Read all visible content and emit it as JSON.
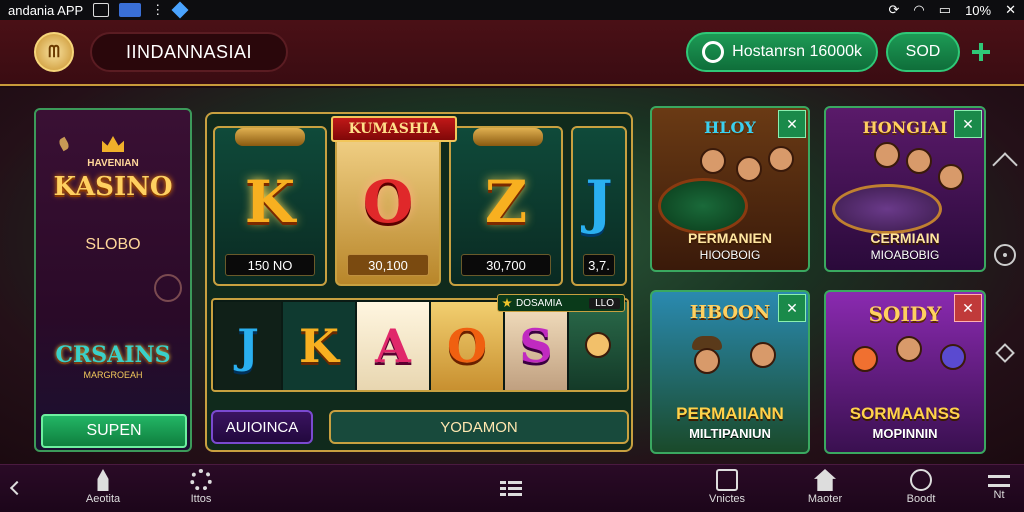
{
  "status_bar": {
    "app_label": "andania APP",
    "battery": "10%"
  },
  "header": {
    "brand": "IINDANNASIAI",
    "balance_label": "Hostanrsn 16000k",
    "sod_label": "SOD"
  },
  "left_panel": {
    "subtitle": "HAVENIAN",
    "title": "KASINO",
    "slobo": "SLOBO",
    "crsains": "CRSAINS",
    "crsains_sub": "MARGROEAH",
    "button": "SUPEN"
  },
  "slot_panel": {
    "banner": "KUMASHIA",
    "reels": [
      {
        "symbol": "K",
        "value": "150 NO"
      },
      {
        "symbol": "O",
        "value": "30,100"
      },
      {
        "symbol": "Z",
        "value": "30,700"
      },
      {
        "symbol": "J",
        "value": "3,7."
      }
    ],
    "lower_tiles": [
      "J",
      "K",
      "A",
      "O",
      "S"
    ],
    "bonus_tag": {
      "label": "DOSAMIA",
      "value": "LLO"
    },
    "btn_left": "AUIOINCA",
    "btn_main": "YODAMON"
  },
  "cards": [
    {
      "title": "HLOY",
      "name": "PERMANIEN",
      "sub": "HIOOBOIG",
      "badge": "✕"
    },
    {
      "title": "HONGIAI",
      "name": "CERMIAIN",
      "sub": "MIOABOBIG",
      "badge": "✕"
    },
    {
      "title": "HBOON",
      "name": "PERMAIIANN",
      "sub": "MILTIPANIUN",
      "badge": "✕"
    },
    {
      "title": "SOIDY",
      "name": "SORMAANSS",
      "sub": "MOPINNIN",
      "badge": "✕"
    }
  ],
  "bottom_nav": {
    "items": [
      {
        "label": "Aeotita",
        "icon": "rocket-icon"
      },
      {
        "label": "Ittos",
        "icon": "gear-icon"
      },
      {
        "label": "Vnictes",
        "icon": "list-icon"
      },
      {
        "label": "Maoter",
        "icon": "home-icon"
      },
      {
        "label": "Boodt",
        "icon": "search-icon"
      },
      {
        "label": "Nt",
        "icon": "more-icon"
      }
    ]
  },
  "colors": {
    "accent_green": "#1d9a55",
    "gold": "#c8a040",
    "header_red": "#4a1016"
  }
}
